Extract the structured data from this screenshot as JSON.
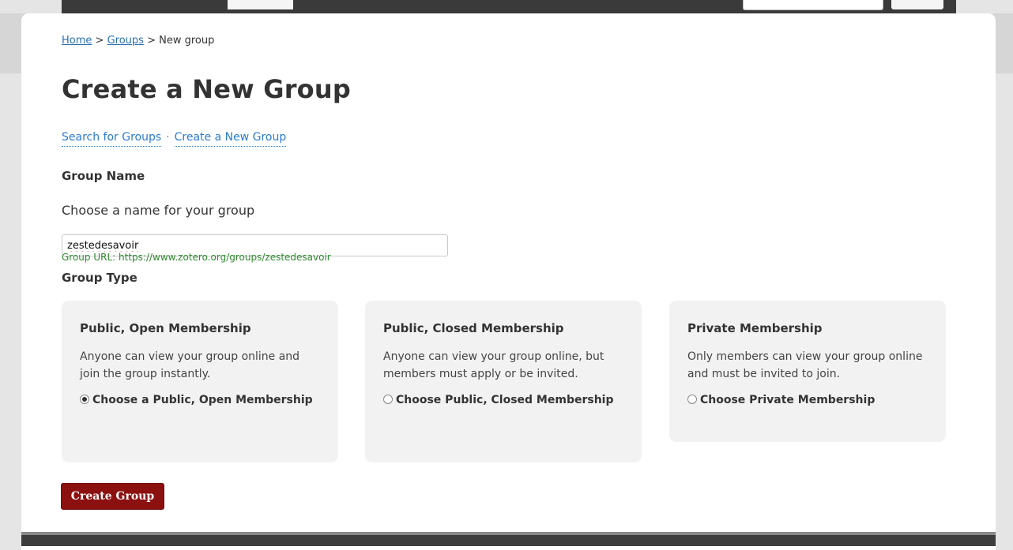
{
  "breadcrumb": {
    "home": "Home",
    "sep1": ">",
    "groups": "Groups",
    "sep2": ">",
    "current": "New group"
  },
  "page_title": "Create a New Group",
  "subnav": {
    "search": "Search for Groups",
    "dot": "·",
    "create": "Create a New Group"
  },
  "group_name": {
    "heading": "Group Name",
    "label": "Choose a name for your group",
    "value": "zestedesavoir",
    "url_text": "Group URL: https://www.zotero.org/groups/zestedesavoir"
  },
  "group_type": {
    "heading": "Group Type",
    "options": [
      {
        "title": "Public, Open Membership",
        "description": "Anyone can view your group online and join the group instantly.",
        "radio_label": "Choose a Public, Open Membership",
        "selected": true
      },
      {
        "title": "Public, Closed Membership",
        "description": "Anyone can view your group online, but members must apply or be invited.",
        "radio_label": "Choose Public, Closed Membership",
        "selected": false
      },
      {
        "title": "Private Membership",
        "description": "Only members can view your group online and must be invited to join.",
        "radio_label": "Choose Private Membership",
        "selected": false
      }
    ]
  },
  "submit": {
    "label": "Create Group"
  },
  "colors": {
    "link": "#2a7bd1",
    "url_green": "#2e8b2e",
    "button_red": "#8c1010",
    "box_bg": "#f2f2f2"
  }
}
